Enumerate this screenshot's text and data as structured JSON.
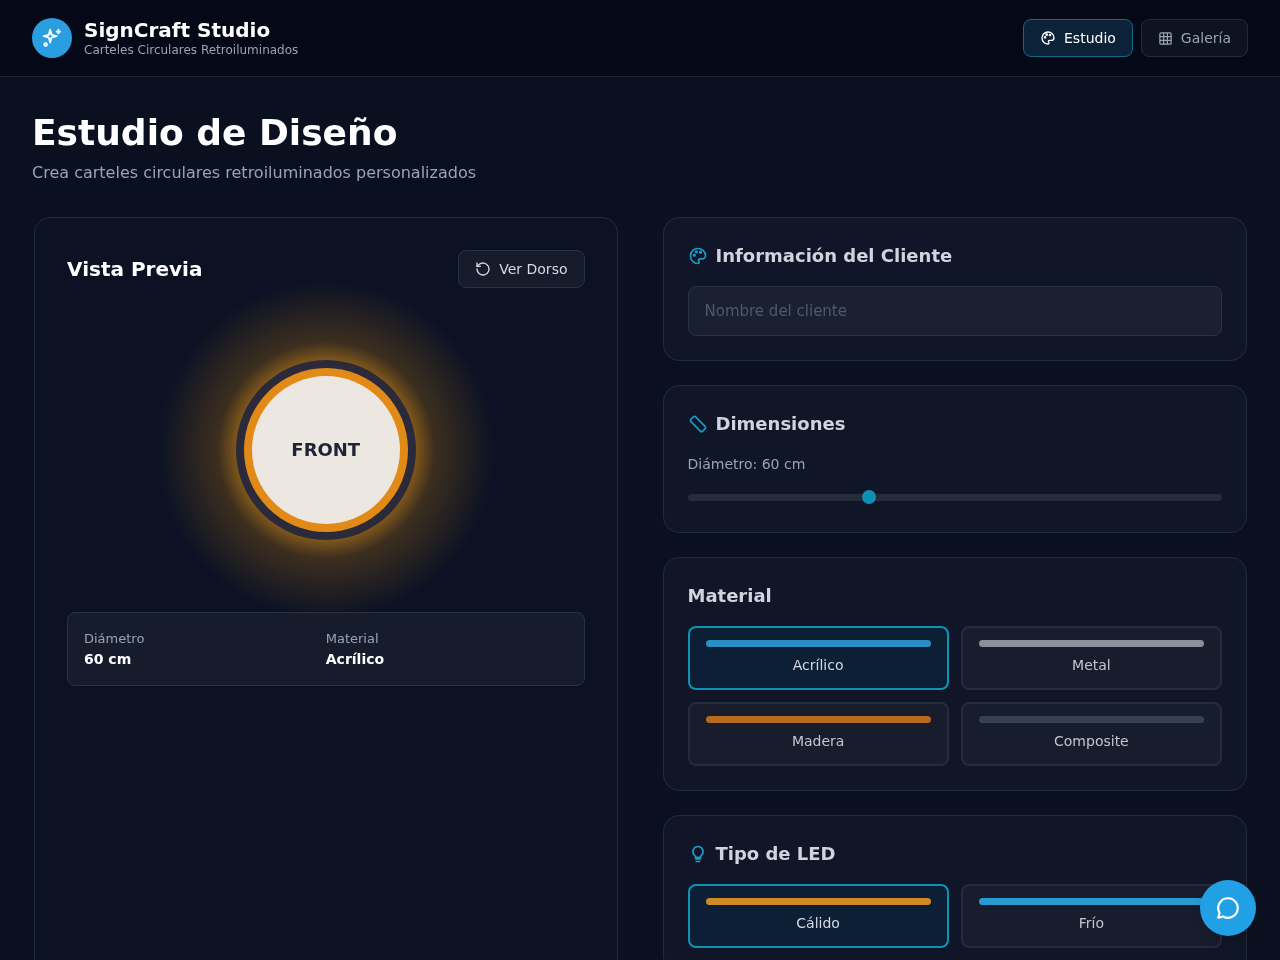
{
  "header": {
    "brand": "SignCraft Studio",
    "tagline": "Carteles Circulares Retroiluminados",
    "nav": [
      {
        "label": "Estudio",
        "selected": true
      },
      {
        "label": "Galería",
        "selected": false
      }
    ]
  },
  "page": {
    "title": "Estudio de Diseño",
    "subtitle": "Crea carteles circulares retroiluminados personalizados"
  },
  "preview": {
    "title": "Vista Previa",
    "flip_button": "Ver Dorso",
    "sign_text": "FRONT",
    "specs": [
      {
        "label": "Diámetro",
        "value": "60 cm"
      },
      {
        "label": "Material",
        "value": "Acrílico"
      }
    ]
  },
  "client": {
    "title": "Información del Cliente",
    "placeholder": "Nombre del cliente"
  },
  "dimensions": {
    "title": "Dimensiones",
    "reading": "Diámetro: 60 cm",
    "level": 0.34
  },
  "material": {
    "title": "Material",
    "options": [
      {
        "label": "Acrílico",
        "color": "#2a8fc7",
        "selected": true
      },
      {
        "label": "Metal",
        "color": "#8a8f99",
        "selected": false
      },
      {
        "label": "Madera",
        "color": "#b8691e",
        "selected": false
      },
      {
        "label": "Composite",
        "color": "#374151",
        "selected": false
      }
    ]
  },
  "led": {
    "title": "Tipo de LED",
    "options": [
      {
        "label": "Cálido",
        "color": "#d08a22",
        "selected": true
      },
      {
        "label": "Frío",
        "color": "#2a9ad0",
        "selected": false
      }
    ]
  }
}
